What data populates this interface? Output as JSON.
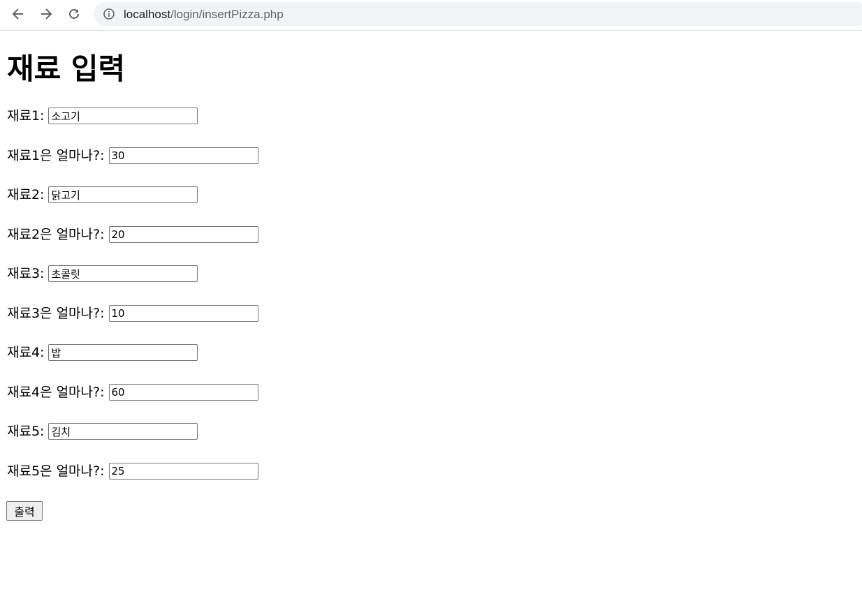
{
  "browser": {
    "url_host": "localhost",
    "url_path": "/login/insertPizza.php"
  },
  "page": {
    "title": "재료 입력",
    "fields": [
      {
        "label": "재료1:",
        "value": "소고기"
      },
      {
        "label": "재료1은 얼마나?:",
        "value": "30"
      },
      {
        "label": "재료2:",
        "value": "닭고기"
      },
      {
        "label": "재료2은 얼마나?:",
        "value": "20"
      },
      {
        "label": "재료3:",
        "value": "초콜릿"
      },
      {
        "label": "재료3은 얼마나?:",
        "value": "10"
      },
      {
        "label": "재료4:",
        "value": "밥"
      },
      {
        "label": "재료4은 얼마나?:",
        "value": "60"
      },
      {
        "label": "재료5:",
        "value": "김치"
      },
      {
        "label": "재료5은 얼마나?:",
        "value": "25"
      }
    ],
    "submit_label": "출력"
  }
}
